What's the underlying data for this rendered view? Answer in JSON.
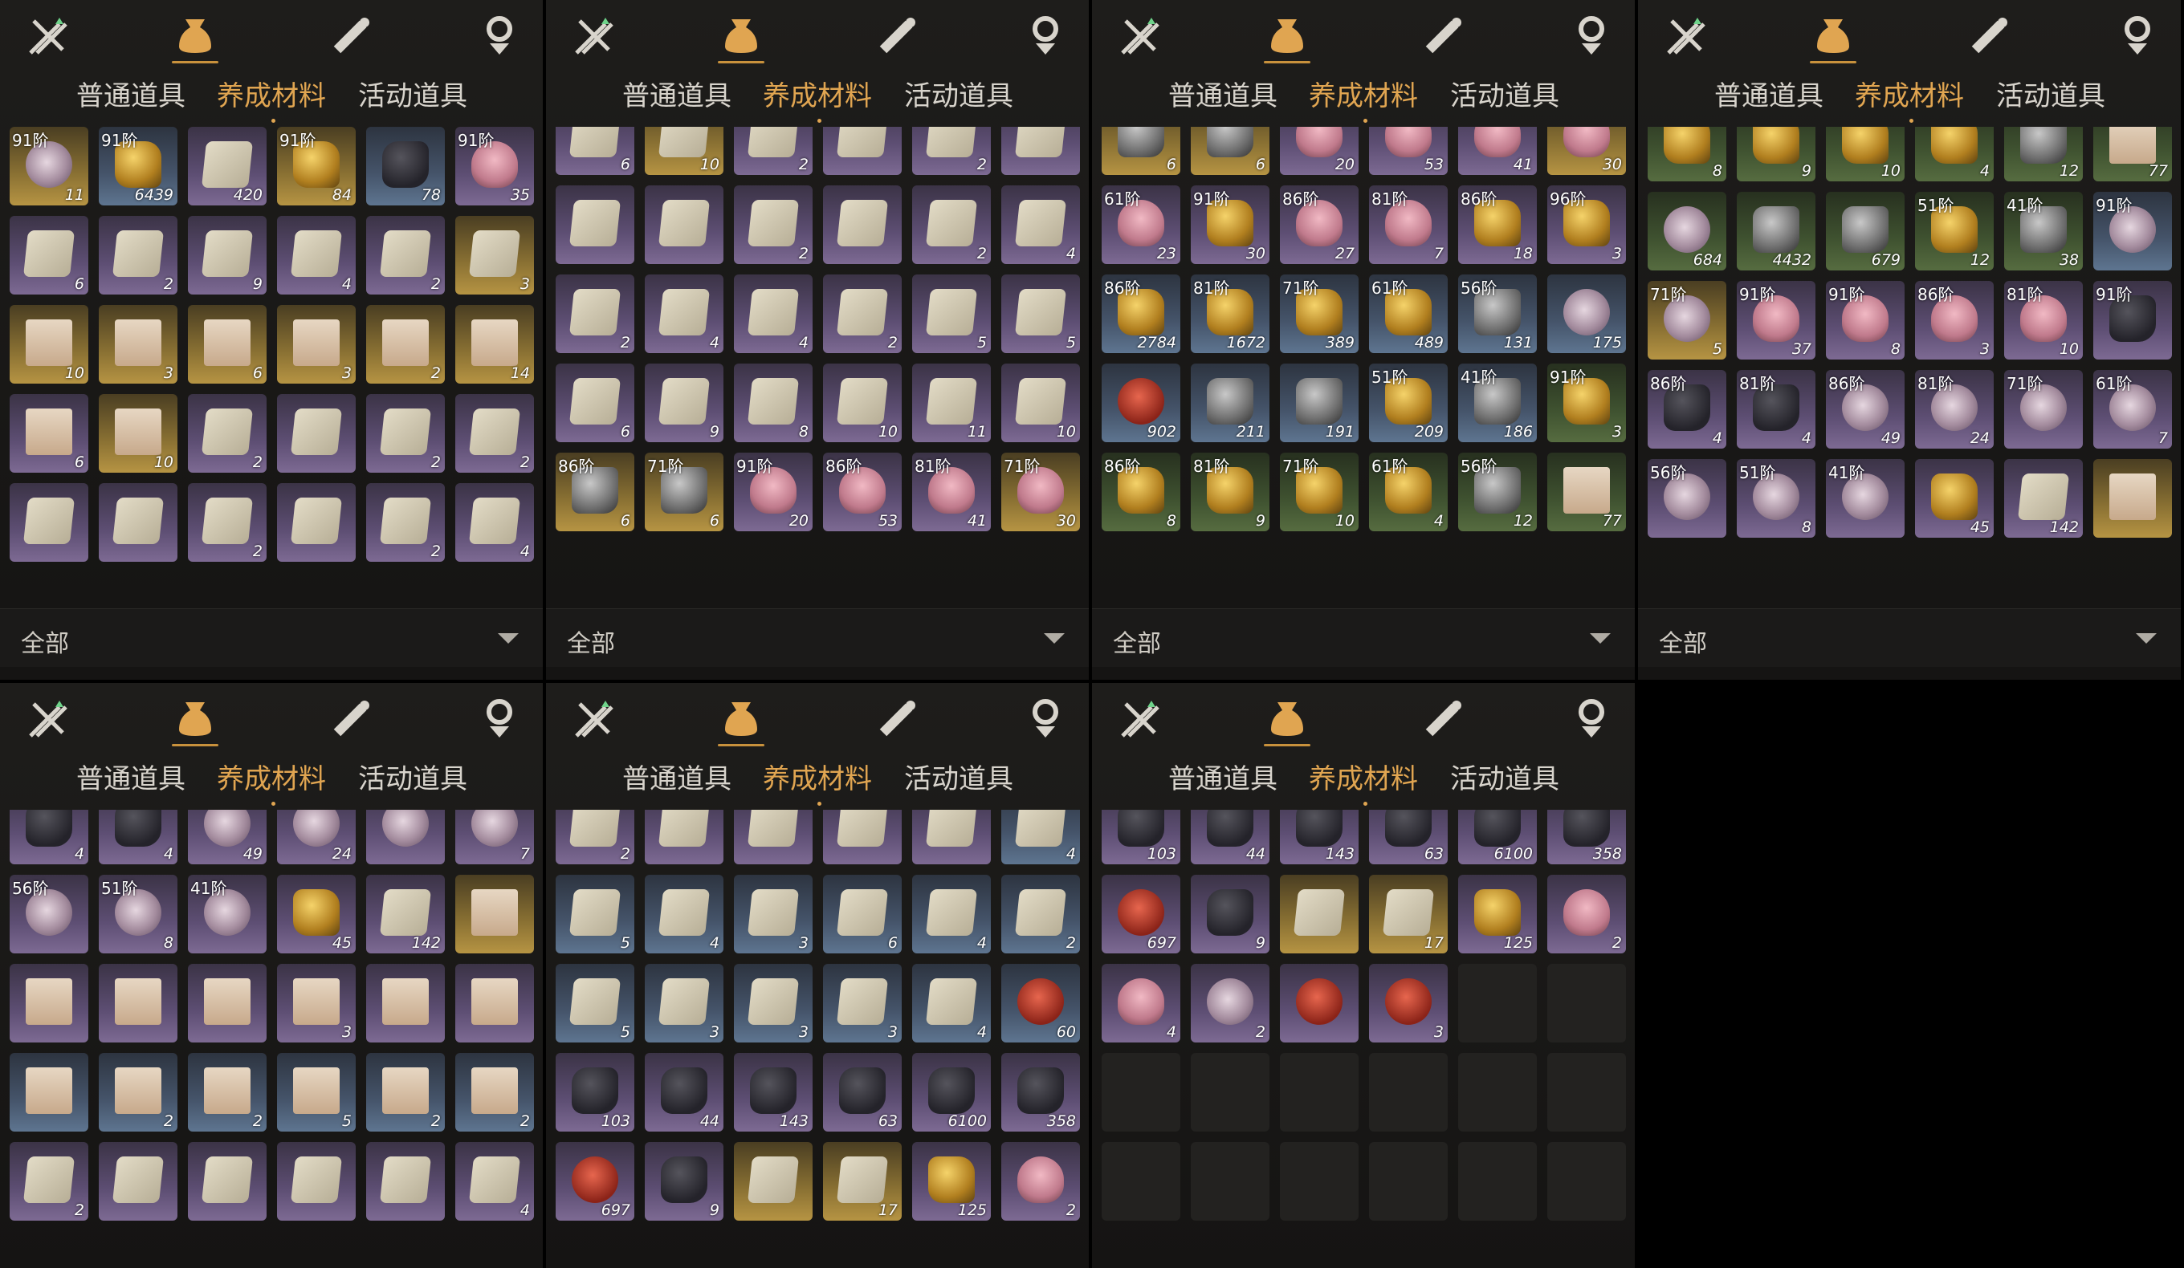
{
  "tabs": {
    "a": "普通道具",
    "b": "养成材料",
    "c": "活动道具"
  },
  "filter_label": "全部",
  "panels": [
    {
      "cells": [
        [
          "gold",
          "shell",
          "91阶",
          "11"
        ],
        [
          "blue",
          "ore",
          "91阶",
          "6439"
        ],
        [
          "purple",
          "book",
          "",
          "420"
        ],
        [
          "gold",
          "ore",
          "91阶",
          "84"
        ],
        [
          "blue",
          "dark",
          "",
          "78"
        ],
        [
          "purple",
          "flower",
          "91阶",
          "35"
        ],
        [
          "purple",
          "book",
          "",
          "6"
        ],
        [
          "purple",
          "book",
          "",
          "2"
        ],
        [
          "purple",
          "book",
          "",
          "9"
        ],
        [
          "purple",
          "book",
          "",
          "4"
        ],
        [
          "purple",
          "book",
          "",
          "2"
        ],
        [
          "gold",
          "book",
          "",
          "3"
        ],
        [
          "gold",
          "scroll",
          "",
          "10"
        ],
        [
          "gold",
          "scroll",
          "",
          "3"
        ],
        [
          "gold",
          "scroll",
          "",
          "6"
        ],
        [
          "gold",
          "scroll",
          "",
          "3"
        ],
        [
          "gold",
          "scroll",
          "",
          "2"
        ],
        [
          "gold",
          "scroll",
          "",
          "14"
        ],
        [
          "purple",
          "scroll",
          "",
          "6"
        ],
        [
          "gold",
          "scroll",
          "",
          "10"
        ],
        [
          "purple",
          "book",
          "",
          "2"
        ],
        [
          "purple",
          "book",
          "",
          ""
        ],
        [
          "purple",
          "book",
          "",
          "2"
        ],
        [
          "purple",
          "book",
          "",
          "2"
        ],
        [
          "purple",
          "book",
          "",
          ""
        ],
        [
          "purple",
          "book",
          "",
          ""
        ],
        [
          "purple",
          "book",
          "",
          "2"
        ],
        [
          "purple",
          "book",
          "",
          ""
        ],
        [
          "purple",
          "book",
          "",
          "2"
        ],
        [
          "purple",
          "book",
          "",
          "4"
        ]
      ]
    },
    {
      "cells": [
        [
          "purple",
          "book",
          "",
          "6"
        ],
        [
          "gold",
          "book",
          "",
          "10"
        ],
        [
          "purple",
          "book",
          "",
          "2"
        ],
        [
          "purple",
          "book",
          "",
          ""
        ],
        [
          "purple",
          "book",
          "",
          "2"
        ],
        [
          "purple",
          "book",
          "",
          ""
        ],
        [
          "purple",
          "book",
          "",
          ""
        ],
        [
          "purple",
          "book",
          "",
          ""
        ],
        [
          "purple",
          "book",
          "",
          "2"
        ],
        [
          "purple",
          "book",
          "",
          ""
        ],
        [
          "purple",
          "book",
          "",
          "2"
        ],
        [
          "purple",
          "book",
          "",
          "4"
        ],
        [
          "purple",
          "book",
          "",
          "2"
        ],
        [
          "purple",
          "book",
          "",
          "4"
        ],
        [
          "purple",
          "book",
          "",
          "4"
        ],
        [
          "purple",
          "book",
          "",
          "2"
        ],
        [
          "purple",
          "book",
          "",
          "5"
        ],
        [
          "purple",
          "book",
          "",
          "5"
        ],
        [
          "purple",
          "book",
          "",
          "6"
        ],
        [
          "purple",
          "book",
          "",
          "9"
        ],
        [
          "purple",
          "book",
          "",
          "8"
        ],
        [
          "purple",
          "book",
          "",
          "10"
        ],
        [
          "purple",
          "book",
          "",
          "11"
        ],
        [
          "purple",
          "book",
          "",
          "10"
        ],
        [
          "gold",
          "stone",
          "86阶",
          "6"
        ],
        [
          "gold",
          "stone",
          "71阶",
          "6"
        ],
        [
          "purple",
          "flower",
          "91阶",
          "20"
        ],
        [
          "purple",
          "flower",
          "86阶",
          "53"
        ],
        [
          "purple",
          "flower",
          "81阶",
          "41"
        ],
        [
          "gold",
          "flower",
          "71阶",
          "30"
        ]
      ]
    },
    {
      "cells": [
        [
          "gold",
          "stone",
          "",
          "6"
        ],
        [
          "gold",
          "stone",
          "",
          "6"
        ],
        [
          "purple",
          "flower",
          "",
          "20"
        ],
        [
          "purple",
          "flower",
          "",
          "53"
        ],
        [
          "purple",
          "flower",
          "",
          "41"
        ],
        [
          "gold",
          "flower",
          "",
          "30"
        ],
        [
          "purple",
          "flower",
          "61阶",
          "23"
        ],
        [
          "purple",
          "ore",
          "91阶",
          "30"
        ],
        [
          "purple",
          "flower",
          "86阶",
          "27"
        ],
        [
          "purple",
          "flower",
          "81阶",
          "7"
        ],
        [
          "purple",
          "ore",
          "86阶",
          "18"
        ],
        [
          "purple",
          "ore",
          "96阶",
          "3"
        ],
        [
          "blue",
          "ore",
          "86阶",
          "2784"
        ],
        [
          "blue",
          "ore",
          "81阶",
          "1672"
        ],
        [
          "blue",
          "ore",
          "71阶",
          "389"
        ],
        [
          "blue",
          "ore",
          "61阶",
          "489"
        ],
        [
          "blue",
          "stone",
          "56阶",
          "131"
        ],
        [
          "blue",
          "shell",
          "",
          "175"
        ],
        [
          "blue",
          "red",
          "",
          "902"
        ],
        [
          "blue",
          "stone",
          "",
          "211"
        ],
        [
          "blue",
          "stone",
          "",
          "191"
        ],
        [
          "blue",
          "ore",
          "51阶",
          "209"
        ],
        [
          "blue",
          "stone",
          "41阶",
          "186"
        ],
        [
          "green",
          "ore",
          "91阶",
          "3"
        ],
        [
          "green",
          "ore",
          "86阶",
          "8"
        ],
        [
          "green",
          "ore",
          "81阶",
          "9"
        ],
        [
          "green",
          "ore",
          "71阶",
          "10"
        ],
        [
          "green",
          "ore",
          "61阶",
          "4"
        ],
        [
          "green",
          "stone",
          "56阶",
          "12"
        ],
        [
          "green",
          "scroll",
          "",
          "77"
        ]
      ]
    },
    {
      "cells": [
        [
          "green",
          "ore",
          "86阶",
          "8"
        ],
        [
          "green",
          "ore",
          "81阶",
          "9"
        ],
        [
          "green",
          "ore",
          "71阶",
          "10"
        ],
        [
          "green",
          "ore",
          "61阶",
          "4"
        ],
        [
          "green",
          "stone",
          "56阶",
          "12"
        ],
        [
          "green",
          "scroll",
          "",
          "77"
        ],
        [
          "green",
          "shell",
          "",
          "684"
        ],
        [
          "green",
          "stone",
          "",
          "4432"
        ],
        [
          "green",
          "stone",
          "",
          "679"
        ],
        [
          "green",
          "ore",
          "51阶",
          "12"
        ],
        [
          "green",
          "stone",
          "41阶",
          "38"
        ],
        [
          "blue",
          "shell",
          "91阶",
          ""
        ],
        [
          "gold",
          "shell",
          "71阶",
          "5"
        ],
        [
          "purple",
          "flower",
          "91阶",
          "37"
        ],
        [
          "purple",
          "flower",
          "91阶",
          "8"
        ],
        [
          "purple",
          "flower",
          "86阶",
          "3"
        ],
        [
          "purple",
          "flower",
          "81阶",
          "10"
        ],
        [
          "purple",
          "dark",
          "91阶",
          ""
        ],
        [
          "purple",
          "dark",
          "86阶",
          "4"
        ],
        [
          "purple",
          "dark",
          "81阶",
          "4"
        ],
        [
          "purple",
          "shell",
          "86阶",
          "49"
        ],
        [
          "purple",
          "shell",
          "81阶",
          "24"
        ],
        [
          "purple",
          "shell",
          "71阶",
          ""
        ],
        [
          "purple",
          "shell",
          "61阶",
          "7"
        ],
        [
          "purple",
          "shell",
          "56阶",
          ""
        ],
        [
          "purple",
          "shell",
          "51阶",
          "8"
        ],
        [
          "purple",
          "shell",
          "41阶",
          ""
        ],
        [
          "purple",
          "ore",
          "",
          "45"
        ],
        [
          "purple",
          "book",
          "",
          "142"
        ],
        [
          "gold",
          "scroll",
          "",
          ""
        ]
      ]
    },
    {
      "cells": [
        [
          "purple",
          "dark",
          "",
          "4"
        ],
        [
          "purple",
          "dark",
          "",
          "4"
        ],
        [
          "purple",
          "shell",
          "",
          "49"
        ],
        [
          "purple",
          "shell",
          "",
          "24"
        ],
        [
          "purple",
          "shell",
          "",
          ""
        ],
        [
          "purple",
          "shell",
          "",
          "7"
        ],
        [
          "purple",
          "shell",
          "56阶",
          ""
        ],
        [
          "purple",
          "shell",
          "51阶",
          "8"
        ],
        [
          "purple",
          "shell",
          "41阶",
          ""
        ],
        [
          "purple",
          "ore",
          "",
          "45"
        ],
        [
          "purple",
          "book",
          "",
          "142"
        ],
        [
          "gold",
          "scroll",
          "",
          ""
        ],
        [
          "purple",
          "scroll",
          "",
          ""
        ],
        [
          "purple",
          "scroll",
          "",
          ""
        ],
        [
          "purple",
          "scroll",
          "",
          ""
        ],
        [
          "purple",
          "scroll",
          "",
          "3"
        ],
        [
          "purple",
          "scroll",
          "",
          ""
        ],
        [
          "purple",
          "scroll",
          "",
          ""
        ],
        [
          "blue",
          "scroll",
          "",
          ""
        ],
        [
          "blue",
          "scroll",
          "",
          "2"
        ],
        [
          "blue",
          "scroll",
          "",
          "2"
        ],
        [
          "blue",
          "scroll",
          "",
          "5"
        ],
        [
          "blue",
          "scroll",
          "",
          "2"
        ],
        [
          "blue",
          "scroll",
          "",
          "2"
        ],
        [
          "purple",
          "book",
          "",
          "2"
        ],
        [
          "purple",
          "book",
          "",
          ""
        ],
        [
          "purple",
          "book",
          "",
          ""
        ],
        [
          "purple",
          "book",
          "",
          ""
        ],
        [
          "purple",
          "book",
          "",
          ""
        ],
        [
          "purple",
          "book",
          "",
          "4"
        ]
      ]
    },
    {
      "cells": [
        [
          "purple",
          "book",
          "",
          "2"
        ],
        [
          "purple",
          "book",
          "",
          ""
        ],
        [
          "purple",
          "book",
          "",
          ""
        ],
        [
          "purple",
          "book",
          "",
          ""
        ],
        [
          "purple",
          "book",
          "",
          ""
        ],
        [
          "blue",
          "book",
          "",
          "4"
        ],
        [
          "blue",
          "book",
          "",
          "5"
        ],
        [
          "blue",
          "book",
          "",
          "4"
        ],
        [
          "blue",
          "book",
          "",
          "3"
        ],
        [
          "blue",
          "book",
          "",
          "6"
        ],
        [
          "blue",
          "book",
          "",
          "4"
        ],
        [
          "blue",
          "book",
          "",
          "2"
        ],
        [
          "blue",
          "book",
          "",
          "5"
        ],
        [
          "blue",
          "book",
          "",
          "3"
        ],
        [
          "blue",
          "book",
          "",
          "3"
        ],
        [
          "blue",
          "book",
          "",
          "3"
        ],
        [
          "blue",
          "book",
          "",
          "4"
        ],
        [
          "blue",
          "red",
          "",
          "60"
        ],
        [
          "purple",
          "dark",
          "",
          "103"
        ],
        [
          "purple",
          "dark",
          "",
          "44"
        ],
        [
          "purple",
          "dark",
          "",
          "143"
        ],
        [
          "purple",
          "dark",
          "",
          "63"
        ],
        [
          "purple",
          "dark",
          "",
          "6100"
        ],
        [
          "purple",
          "dark",
          "",
          "358"
        ],
        [
          "purple",
          "red",
          "",
          "697"
        ],
        [
          "purple",
          "dark",
          "",
          "9"
        ],
        [
          "gold",
          "book",
          "",
          ""
        ],
        [
          "gold",
          "book",
          "",
          "17"
        ],
        [
          "purple",
          "ore",
          "",
          "125"
        ],
        [
          "purple",
          "flower",
          "",
          "2"
        ]
      ]
    },
    {
      "cells": [
        [
          "purple",
          "dark",
          "",
          "103"
        ],
        [
          "purple",
          "dark",
          "",
          "44"
        ],
        [
          "purple",
          "dark",
          "",
          "143"
        ],
        [
          "purple",
          "dark",
          "",
          "63"
        ],
        [
          "purple",
          "dark",
          "",
          "6100"
        ],
        [
          "purple",
          "dark",
          "",
          "358"
        ],
        [
          "purple",
          "red",
          "",
          "697"
        ],
        [
          "purple",
          "dark",
          "",
          "9"
        ],
        [
          "gold",
          "book",
          "",
          ""
        ],
        [
          "gold",
          "book",
          "",
          "17"
        ],
        [
          "purple",
          "ore",
          "",
          "125"
        ],
        [
          "purple",
          "flower",
          "",
          "2"
        ],
        [
          "purple",
          "flower",
          "",
          "4"
        ],
        [
          "purple",
          "shell",
          "",
          "2"
        ],
        [
          "purple",
          "red",
          "",
          ""
        ],
        [
          "purple",
          "red",
          "",
          "3"
        ],
        [
          "empty",
          "",
          "",
          ""
        ],
        [
          "empty",
          "",
          "",
          ""
        ],
        [
          "empty",
          "",
          "",
          ""
        ],
        [
          "empty",
          "",
          "",
          ""
        ],
        [
          "empty",
          "",
          "",
          ""
        ],
        [
          "empty",
          "",
          "",
          ""
        ],
        [
          "empty",
          "",
          "",
          ""
        ],
        [
          "empty",
          "",
          "",
          ""
        ],
        [
          "empty",
          "",
          "",
          ""
        ],
        [
          "empty",
          "",
          "",
          ""
        ],
        [
          "empty",
          "",
          "",
          ""
        ],
        [
          "empty",
          "",
          "",
          ""
        ],
        [
          "empty",
          "",
          "",
          ""
        ],
        [
          "empty",
          "",
          "",
          ""
        ]
      ]
    }
  ]
}
